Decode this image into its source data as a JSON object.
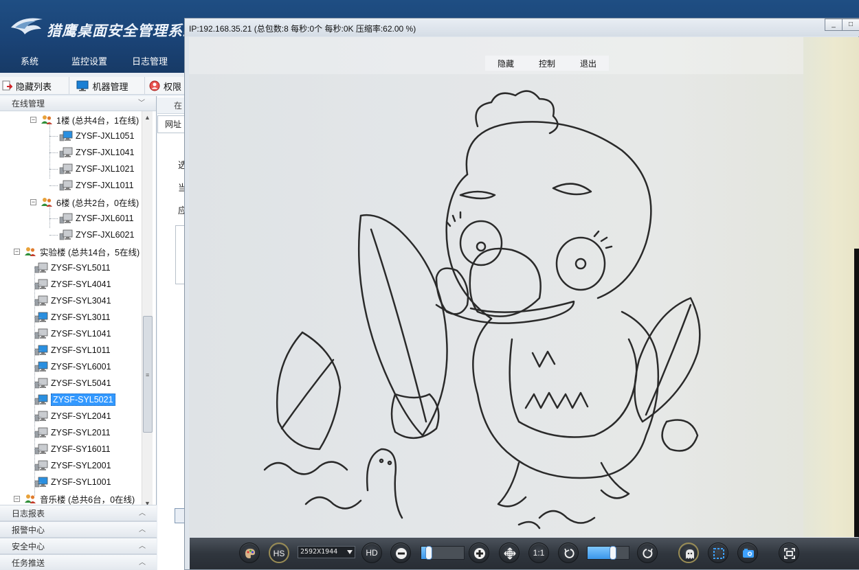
{
  "app": {
    "title": "猎鹰桌面安全管理系统",
    "menu": [
      "系统",
      "监控设置",
      "日志管理"
    ],
    "toolbar": [
      {
        "label": "隐藏列表",
        "icon": "hide-list-icon"
      },
      {
        "label": "机器管理",
        "icon": "monitor-icon"
      },
      {
        "label": "权限",
        "icon": "permission-icon"
      }
    ]
  },
  "sidebar": {
    "online_header": "在线管理",
    "tree": [
      {
        "type": "group",
        "label": "1楼 (总共4台，1在线)",
        "level": 1,
        "expanded": true
      },
      {
        "type": "pc",
        "label": "ZYSF-JXL1051",
        "level": 2,
        "online": true
      },
      {
        "type": "pc",
        "label": "ZYSF-JXL1041",
        "level": 2,
        "online": false
      },
      {
        "type": "pc",
        "label": "ZYSF-JXL1021",
        "level": 2,
        "online": false
      },
      {
        "type": "pc",
        "label": "ZYSF-JXL1011",
        "level": 2,
        "online": false
      },
      {
        "type": "group",
        "label": "6楼 (总共2台，0在线)",
        "level": 1,
        "expanded": true
      },
      {
        "type": "pc",
        "label": "ZYSF-JXL6011",
        "level": 2,
        "online": false
      },
      {
        "type": "pc",
        "label": "ZYSF-JXL6021",
        "level": 2,
        "online": false
      },
      {
        "type": "group",
        "label": "实验楼 (总共14台，5在线)",
        "level": 0,
        "expanded": true
      },
      {
        "type": "pc",
        "label": "ZYSF-SYL5011",
        "level": 1,
        "online": false
      },
      {
        "type": "pc",
        "label": "ZYSF-SYL4041",
        "level": 1,
        "online": false
      },
      {
        "type": "pc",
        "label": "ZYSF-SYL3041",
        "level": 1,
        "online": false
      },
      {
        "type": "pc",
        "label": "ZYSF-SYL3011",
        "level": 1,
        "online": true
      },
      {
        "type": "pc",
        "label": "ZYSF-SYL1041",
        "level": 1,
        "online": false
      },
      {
        "type": "pc",
        "label": "ZYSF-SYL1011",
        "level": 1,
        "online": true
      },
      {
        "type": "pc",
        "label": "ZYSF-SYL6001",
        "level": 1,
        "online": true
      },
      {
        "type": "pc",
        "label": "ZYSF-SYL5041",
        "level": 1,
        "online": false
      },
      {
        "type": "pc",
        "label": "ZYSF-SYL5021",
        "level": 1,
        "online": true,
        "selected": true
      },
      {
        "type": "pc",
        "label": "ZYSF-SYL2041",
        "level": 1,
        "online": false
      },
      {
        "type": "pc",
        "label": "ZYSF-SYL2011",
        "level": 1,
        "online": false
      },
      {
        "type": "pc",
        "label": "ZYSF-SY16011",
        "level": 1,
        "online": false
      },
      {
        "type": "pc",
        "label": "ZYSF-SYL2001",
        "level": 1,
        "online": false
      },
      {
        "type": "pc",
        "label": "ZYSF-SYL1001",
        "level": 1,
        "online": true
      },
      {
        "type": "group",
        "label": "音乐楼 (总共6台，0在线)",
        "level": 0,
        "expanded": true
      }
    ],
    "bottom_panels": [
      "日志报表",
      "报警中心",
      "安全中心",
      "任务推送"
    ]
  },
  "content": {
    "tab_fragment": "在",
    "addr_fragment": "网址",
    "row_fragments": [
      "选",
      "当",
      "应"
    ]
  },
  "viewer": {
    "status": {
      "ip": "IP:192.168.35.21",
      "packets": "(总包数:8",
      "per_sec_count": "每秒:0个",
      "per_sec_bytes": "每秒:0K",
      "compression": "压缩率:62.00 %)"
    },
    "floating_menu": [
      "隐藏",
      "控制",
      "退出"
    ],
    "window_buttons": [
      "_",
      "□"
    ],
    "controls": {
      "hs_label": "HS",
      "resolution": "2592X1944",
      "hd_label": "HD",
      "ratio_label": "1:1",
      "zoom_level": 0.18,
      "rotation_level": 0.62
    },
    "colors": {
      "accent": "#3399ff",
      "header": "#1f4e83",
      "control_bar": "#30363e"
    }
  }
}
